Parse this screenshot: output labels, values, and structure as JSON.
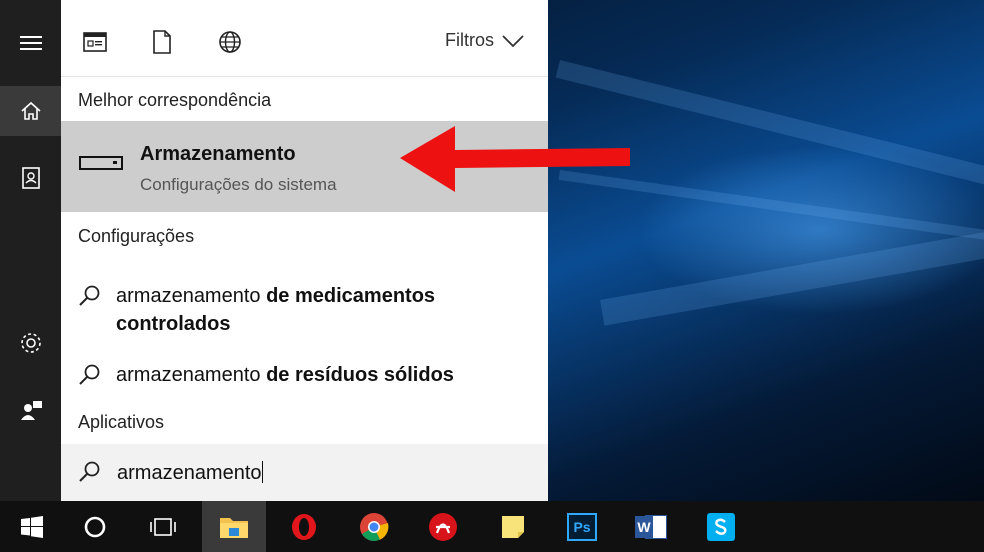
{
  "search_panel": {
    "filters_label": "Filtros",
    "sections": {
      "best_match_header": "Melhor correspondência",
      "settings_header": "Configurações",
      "apps_header": "Aplicativos"
    },
    "best_match": {
      "title": "Armazenamento",
      "subtitle": "Configurações do sistema"
    },
    "suggestions": [
      {
        "typed": "armazenamento",
        "completion": "de medicamentos",
        "completion2": "controlados"
      },
      {
        "typed": "armazenamento",
        "completion": "de resíduos sólidos"
      }
    ],
    "query": "armazenamento"
  },
  "left_rail": {
    "items": [
      "menu-icon",
      "home-icon",
      "notebook-icon",
      "gear-icon",
      "feedback-icon"
    ]
  },
  "taskbar": {
    "items": [
      "windows-start-icon",
      "cortana-icon",
      "task-view-icon",
      "file-explorer-icon",
      "opera-icon",
      "chrome-icon",
      "acrobat-icon",
      "sticky-notes-icon",
      "photoshop-icon",
      "word-icon",
      "skype-icon"
    ],
    "labels": {
      "photoshop": "Ps",
      "word": "W"
    }
  },
  "colors": {
    "annotation_arrow": "#ee1111",
    "selection": "#cdcdcd"
  }
}
